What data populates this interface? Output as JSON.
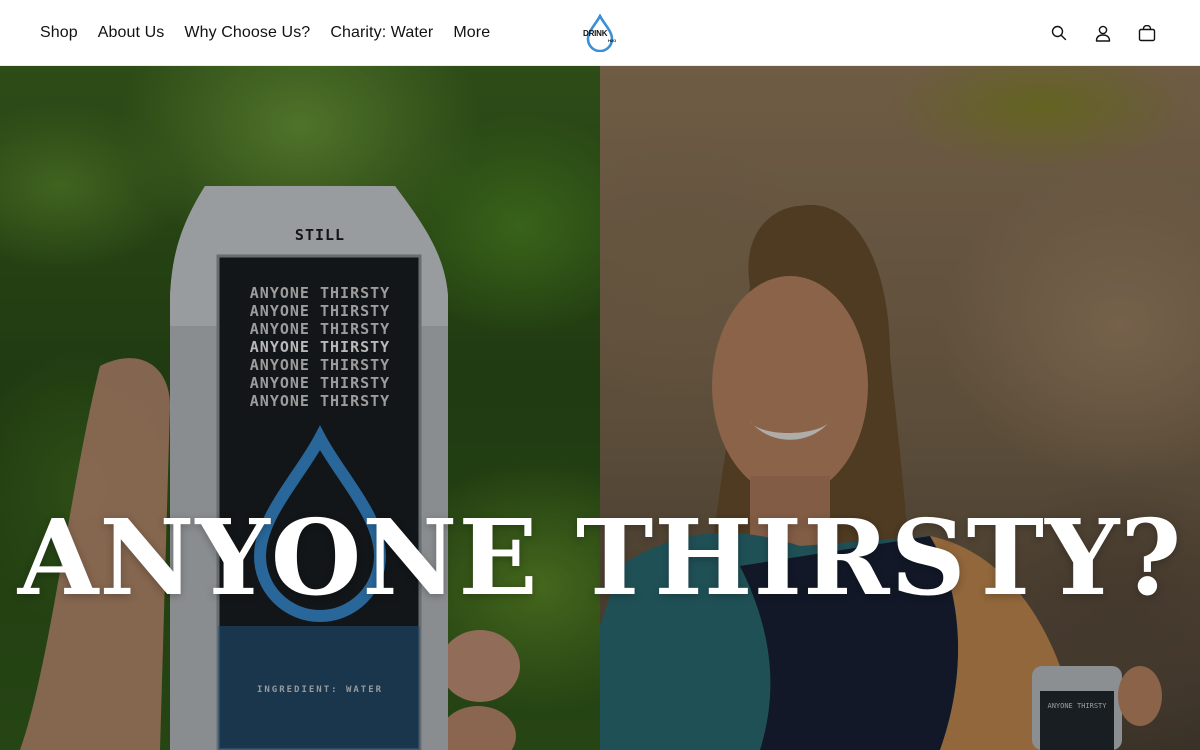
{
  "header": {
    "nav": [
      {
        "label": "Shop"
      },
      {
        "label": "About Us"
      },
      {
        "label": "Why Choose Us?"
      },
      {
        "label": "Charity: Water"
      },
      {
        "label": "More"
      }
    ],
    "logo": {
      "text": "DRINK",
      "sub": "H2O"
    },
    "icons": [
      "search-icon",
      "account-icon",
      "cart-icon"
    ]
  },
  "hero": {
    "title": "ANYONE THIRSTY?",
    "can": {
      "still_label": "STILL",
      "lines": [
        "ANYONE THIRSTY",
        "ANYONE THIRSTY",
        "ANYONE THIRSTY",
        "ANYONE THIRSTY",
        "ANYONE THIRSTY",
        "ANYONE THIRSTY",
        "ANYONE THIRSTY"
      ],
      "ingredient": "INGREDIENT: WATER"
    },
    "small_can_label": "ANYONE THIRSTY"
  },
  "colors": {
    "header_bg": "#ffffff",
    "nav_text": "#121212",
    "logo_blue": "#3a8fd6",
    "hero_text": "#ffffff"
  }
}
